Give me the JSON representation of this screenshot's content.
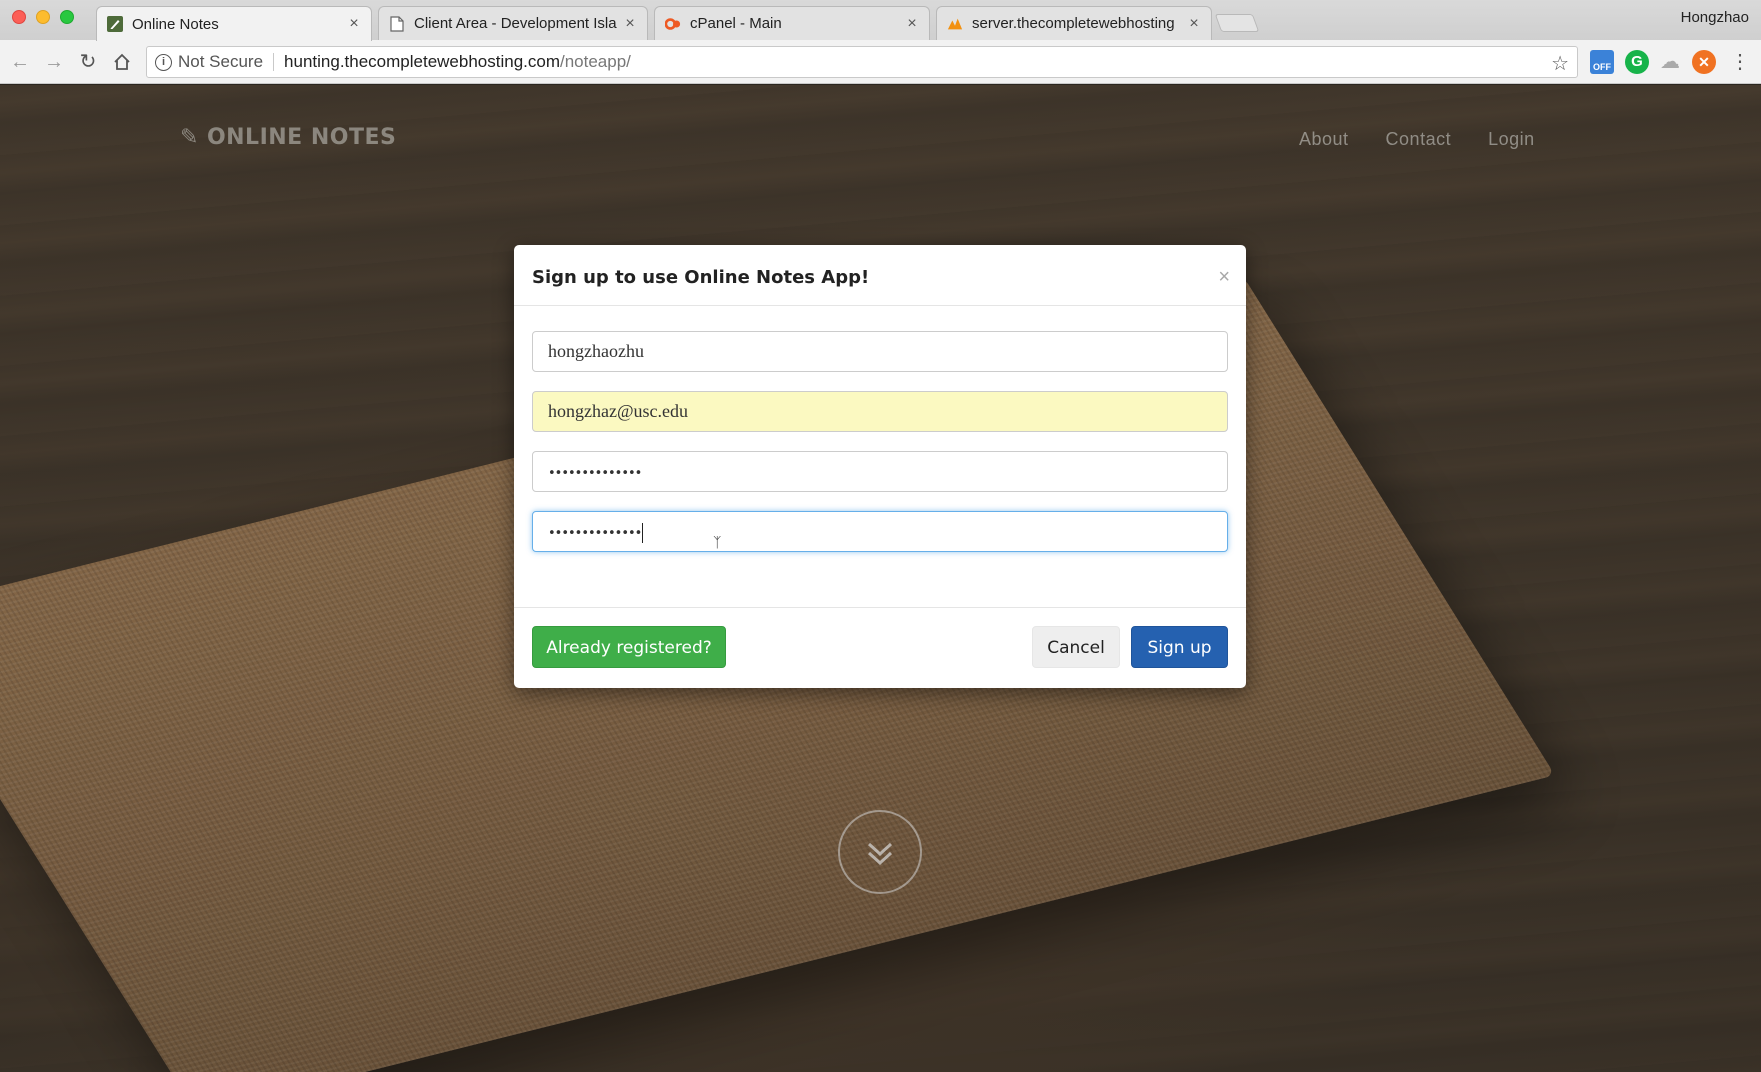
{
  "browser": {
    "tabs": [
      {
        "title": "Online Notes",
        "icon": "notes-favicon",
        "active": true
      },
      {
        "title": "Client Area - Development Isla",
        "icon": "document-icon",
        "active": false
      },
      {
        "title": "cPanel - Main",
        "icon": "cpanel-icon",
        "active": false
      },
      {
        "title": "server.thecompletewebhosting",
        "icon": "phpmyadmin-icon",
        "active": false
      }
    ],
    "tab_close": "×",
    "profile_name": "Hongzhao",
    "address_bar": {
      "security_label": "Not Secure",
      "host": "hunting.thecompletewebhosting.com",
      "path": "/noteapp/"
    },
    "extensions": {
      "off_badge": "OFF",
      "grammarly": "G"
    }
  },
  "site": {
    "brand": "ONLINE NOTES",
    "nav": [
      "About",
      "Contact",
      "Login"
    ]
  },
  "modal": {
    "title": "Sign up to use Online Notes App!",
    "close_glyph": "×",
    "fields": {
      "username": "hongzhaozhu",
      "email": "hongzhaz@usc.edu",
      "password": "••••••••••••••",
      "password_confirm": "••••••••••••••"
    },
    "buttons": {
      "already_registered": "Already registered?",
      "cancel": "Cancel",
      "sign_up": "Sign up"
    }
  },
  "colors": {
    "primary": "#2561b0",
    "success": "#3fae49",
    "autofill": "#fbf9c1",
    "focus": "#66afe9"
  }
}
